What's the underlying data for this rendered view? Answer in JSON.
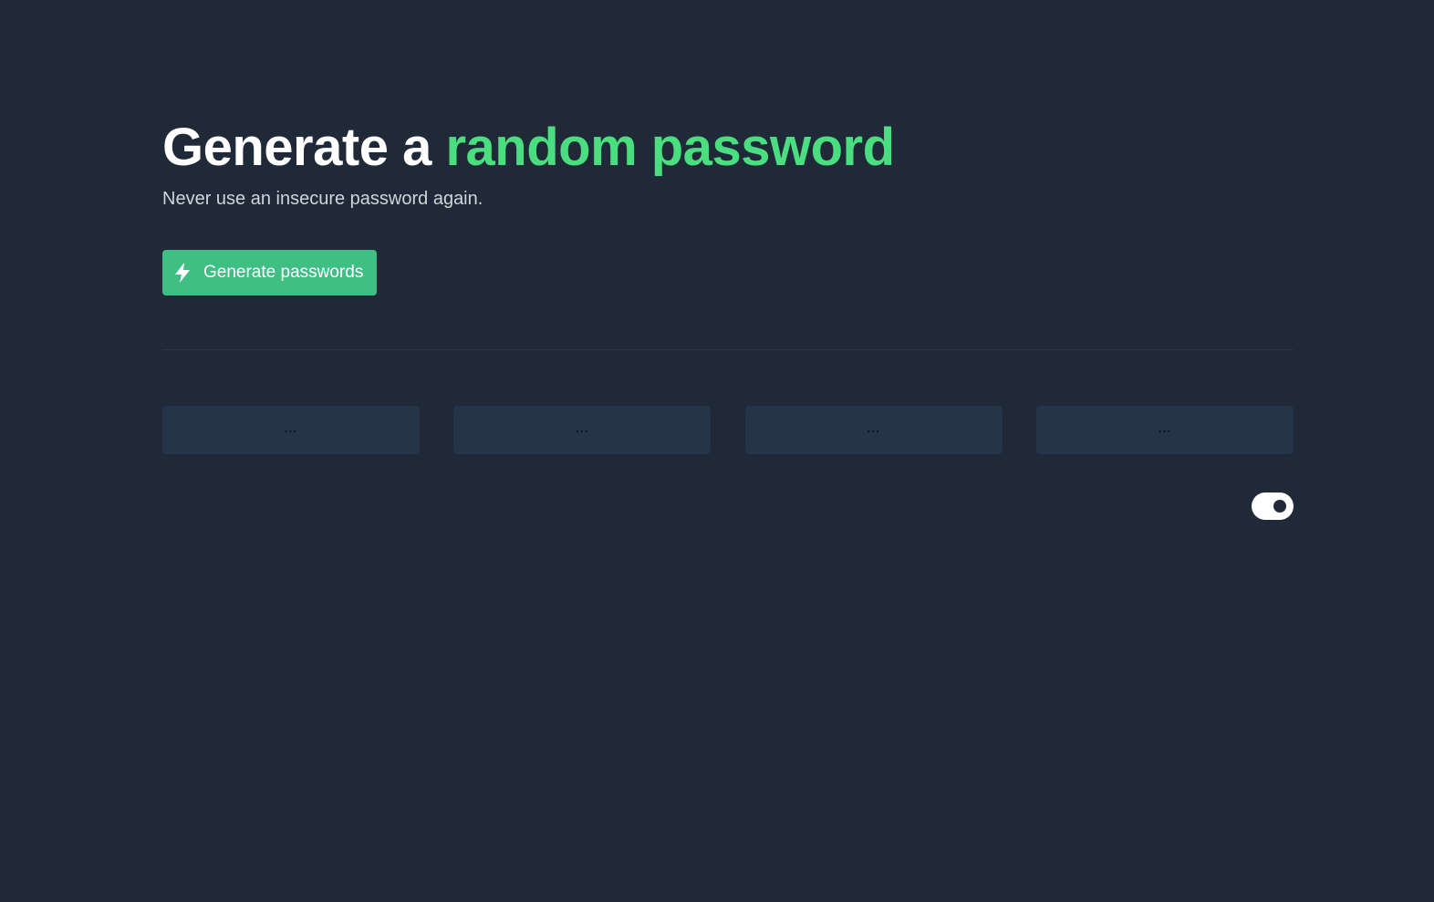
{
  "hero": {
    "title_prefix": "Generate a ",
    "title_accent": "random password",
    "subtitle": "Never use an insecure password again."
  },
  "actions": {
    "generate_label": "Generate passwords",
    "generate_icon": "lightning-bolt-icon"
  },
  "passwords": [
    {
      "value": "..."
    },
    {
      "value": "..."
    },
    {
      "value": "..."
    },
    {
      "value": "..."
    }
  ],
  "toggle": {
    "state": "on",
    "icon": "toggle-switch-icon"
  },
  "colors": {
    "background": "#1f2937",
    "accent_text": "#4ade80",
    "button": "#3fbf84",
    "card": "#263449"
  }
}
